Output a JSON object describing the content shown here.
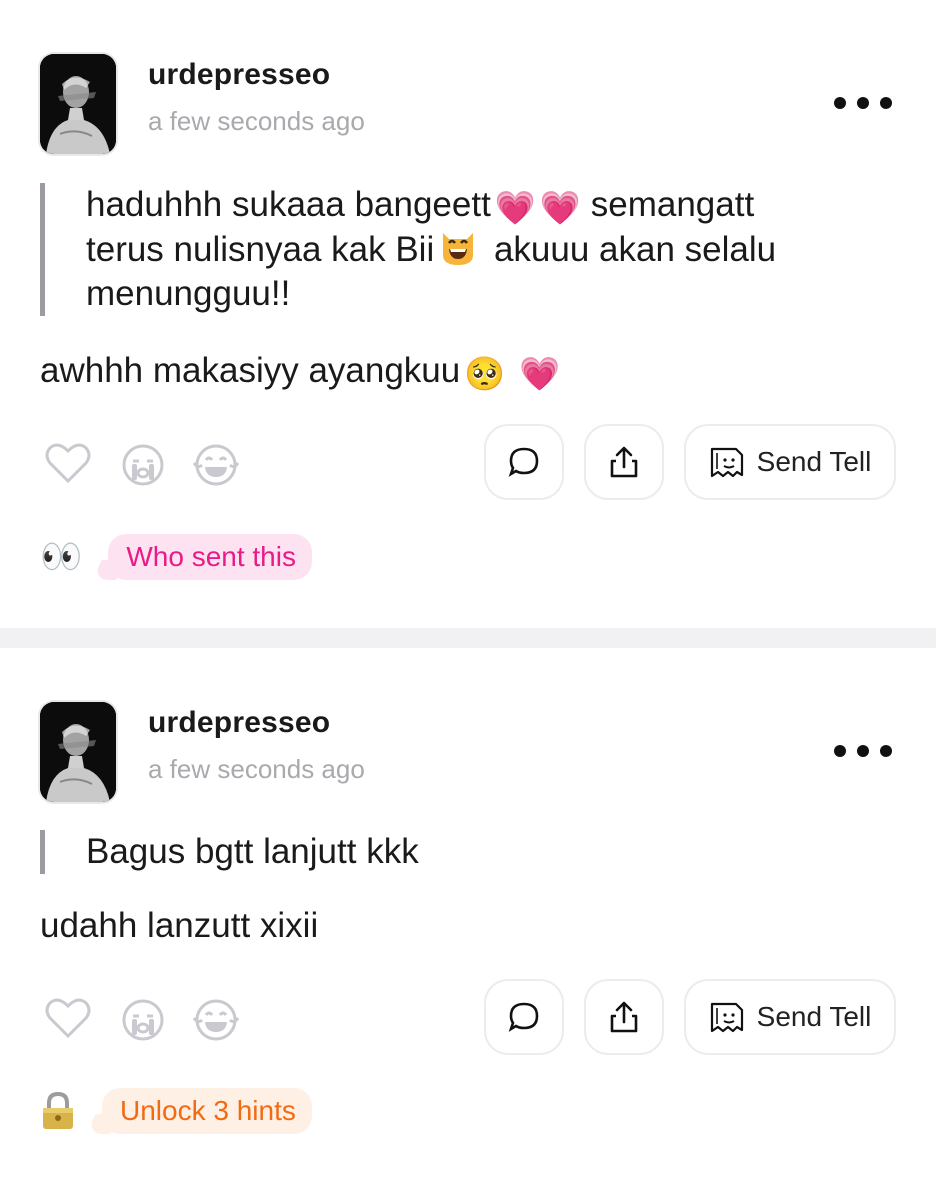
{
  "posts": [
    {
      "username": "urdepresseo",
      "timestamp": "a few seconds ago",
      "message_parts": [
        "haduhhh sukaaa bangeett",
        "semangatt",
        "terus nulisnyaa kak Bii",
        "akuuu akan selalu",
        "menungguu!!"
      ],
      "reply_text": "awhhh makasiyy ayangkuu",
      "hint_label": "Who sent this",
      "hint_icon": "eyes-icon",
      "send_label": "Send Tell"
    },
    {
      "username": "urdepresseo",
      "timestamp": "a few seconds ago",
      "message_parts": [
        "Bagus bgtt lanjutt kkk"
      ],
      "reply_text": "udahh lanzutt xixii",
      "hint_label": "Unlock 3 hints",
      "hint_icon": "lock-icon",
      "send_label": "Send Tell"
    }
  ],
  "colors": {
    "hint_pink": "#ea1b86",
    "hint_pink_bg": "#fde3f1",
    "hint_orange": "#f26a12",
    "hint_orange_bg": "#fff0e5",
    "divider": "#f1f1f4",
    "muted": "#a9a9ae"
  }
}
